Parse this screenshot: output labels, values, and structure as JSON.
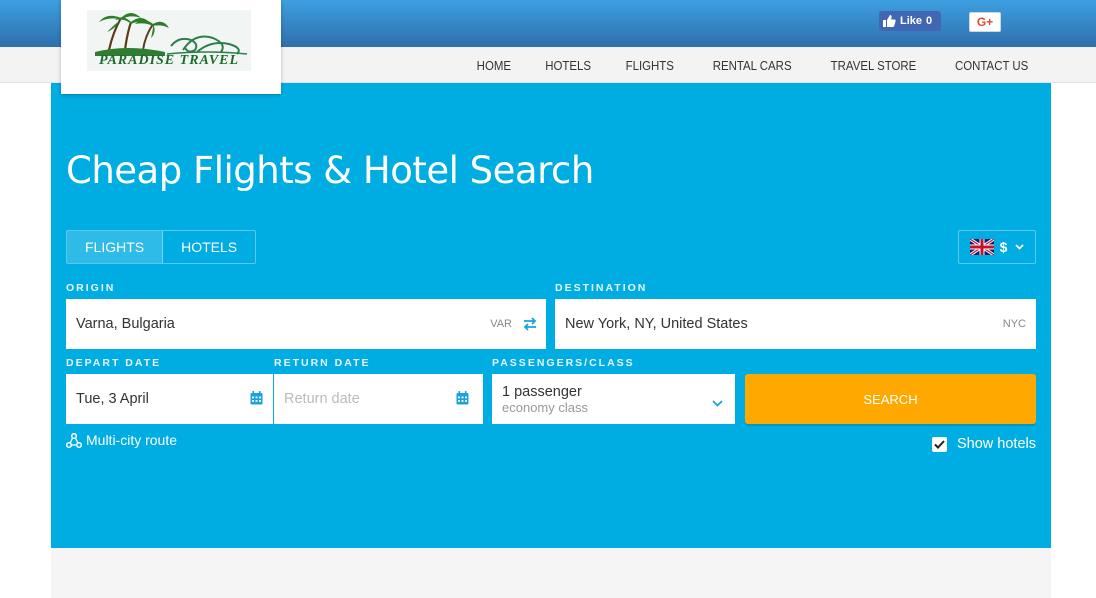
{
  "header": {
    "logo_text": "PARADISE TRAVEL",
    "facebook_like_label": "Like",
    "facebook_like_count": "0",
    "gplus_label": "G+"
  },
  "nav": {
    "items": [
      {
        "label": "HOME"
      },
      {
        "label": "HOTELS"
      },
      {
        "label": "FLIGHTS"
      },
      {
        "label": "RENTAL CARS"
      },
      {
        "label": "TRAVEL STORE"
      },
      {
        "label": "CONTACT US"
      }
    ]
  },
  "search": {
    "title": "Cheap Flights & Hotel Search",
    "tabs": [
      {
        "label": "FLIGHTS",
        "active": true
      },
      {
        "label": "HOTELS",
        "active": false
      }
    ],
    "currency": {
      "symbol": "$",
      "flag": "uk-flag-icon"
    },
    "origin": {
      "label": "ORIGIN",
      "value": "Varna, Bulgaria",
      "code": "VAR"
    },
    "destination": {
      "label": "DESTINATION",
      "value": "New York, NY, United States",
      "code": "NYC"
    },
    "depart": {
      "label": "DEPART DATE",
      "value": "Tue, 3 April"
    },
    "return": {
      "label": "RETURN DATE",
      "placeholder": "Return date"
    },
    "passengers": {
      "label": "PASSENGERS/CLASS",
      "count_text": "1 passenger",
      "class_text": "economy class"
    },
    "search_button": "SEARCH",
    "multi_city": "Multi-city route",
    "show_hotels": {
      "label": "Show hotels",
      "checked": true
    }
  },
  "colors": {
    "hero": "#00ade2",
    "search_button": "#ffa800",
    "topbar_top": "#3d9fe0",
    "topbar_bottom": "#2f6fae",
    "icon_accent": "#1aa3d8"
  }
}
